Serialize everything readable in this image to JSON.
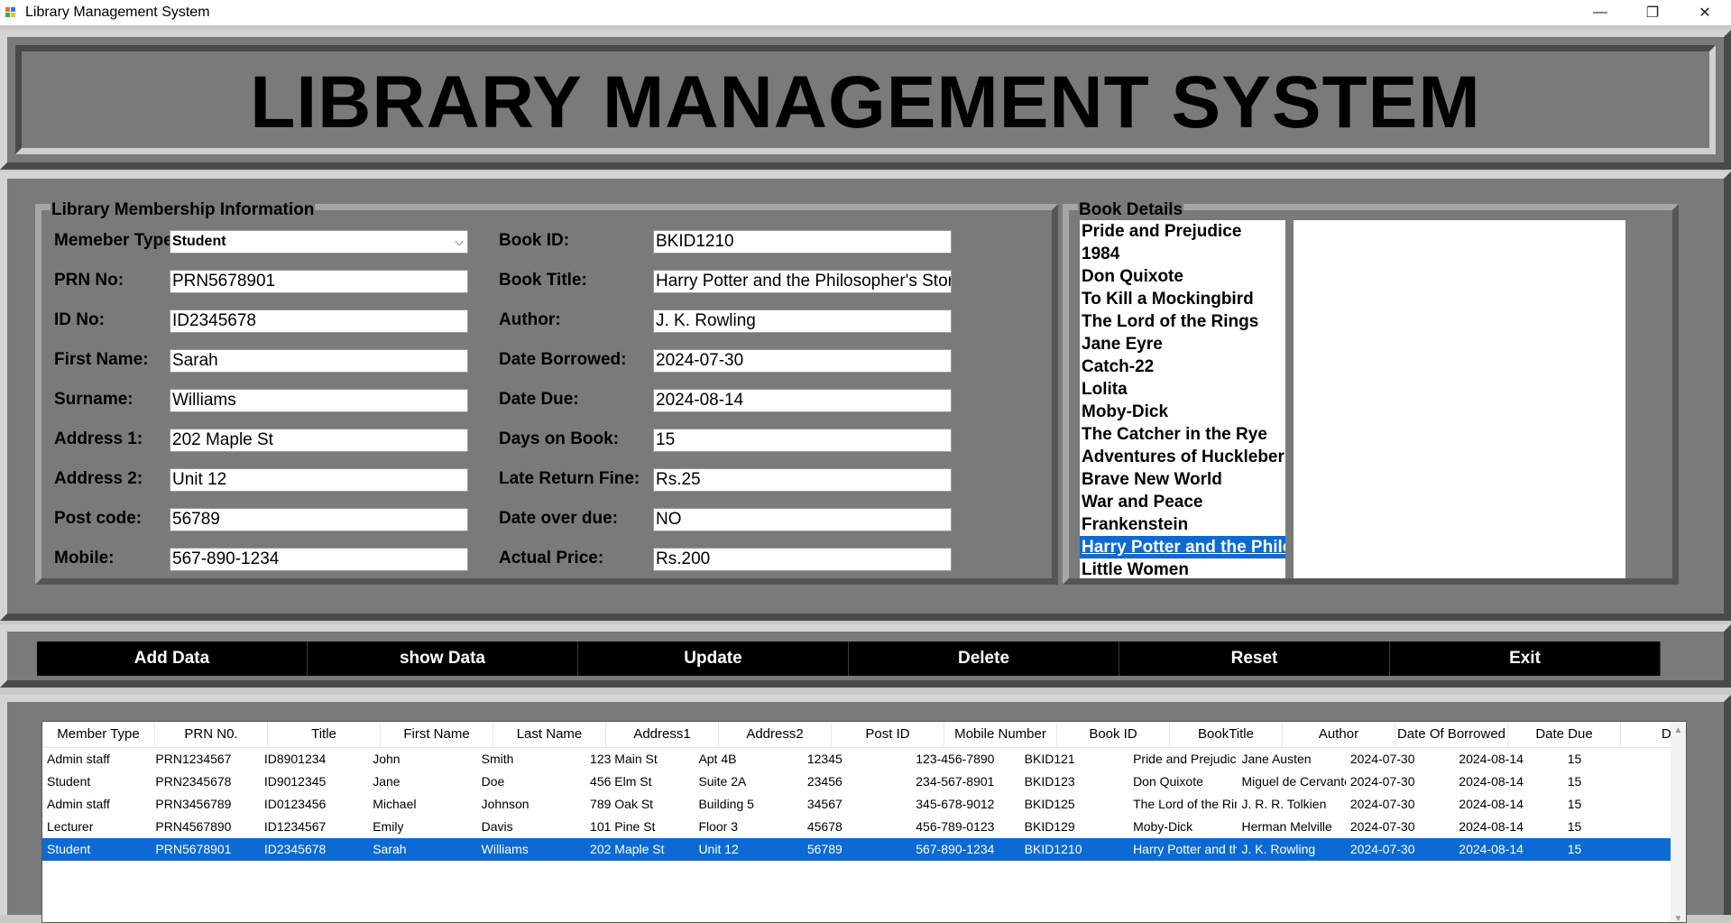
{
  "window": {
    "title": "Library Management System",
    "controls": {
      "minimize": "—",
      "maximize": "❐",
      "close": "✕"
    }
  },
  "header": {
    "title": "LIBRARY MANAGEMENT SYSTEM"
  },
  "membership": {
    "legend": "Library Membership Information",
    "member_type_label": "Memeber Type:",
    "member_type_value": "Student",
    "prn_label": "PRN No:",
    "prn_value": "PRN5678901",
    "id_label": "ID No:",
    "id_value": "ID2345678",
    "first_name_label": "First Name:",
    "first_name_value": "Sarah",
    "surname_label": "Surname:",
    "surname_value": "Williams",
    "address1_label": "Address 1:",
    "address1_value": "202 Maple St",
    "address2_label": "Address 2:",
    "address2_value": "Unit 12",
    "postcode_label": "Post code:",
    "postcode_value": "56789",
    "mobile_label": "Mobile:",
    "mobile_value": "567-890-1234",
    "book_id_label": "Book ID:",
    "book_id_value": "BKID1210",
    "book_title_label": "Book Title:",
    "book_title_value": "Harry Potter and the Philosopher's Stone",
    "author_label": "Author:",
    "author_value": "J. K. Rowling",
    "date_borrowed_label": "Date Borrowed:",
    "date_borrowed_value": "2024-07-30",
    "date_due_label": "Date Due:",
    "date_due_value": "2024-08-14",
    "days_on_book_label": "Days on Book:",
    "days_on_book_value": "15",
    "late_fine_label": "Late Return Fine:",
    "late_fine_value": "Rs.25",
    "date_overdue_label": "Date over due:",
    "date_overdue_value": "NO",
    "actual_price_label": "Actual Price:",
    "actual_price_value": "Rs.200"
  },
  "book_details": {
    "legend": "Book Details",
    "books": [
      "Pride and Prejudice",
      "1984",
      "Don Quixote",
      "To Kill a Mockingbird",
      "The Lord of the Rings",
      "Jane Eyre",
      "Catch-22",
      "Lolita",
      "Moby-Dick",
      "The Catcher in the Rye",
      "Adventures of Huckleberry Finn",
      "Brave New World",
      "War and Peace",
      "Frankenstein",
      "Harry Potter and the Philosopher's Stone",
      "Little Women"
    ],
    "selected_index": 14
  },
  "buttons": [
    "Add Data",
    "show Data",
    "Update",
    "Delete",
    "Reset",
    "Exit"
  ],
  "table": {
    "columns": [
      "Member Type",
      "PRN N0.",
      "Title",
      "First Name",
      "Last Name",
      "Address1",
      "Address2",
      "Post ID",
      "Mobile Number",
      "Book ID",
      "BookTitle",
      "Author",
      "Date Of Borrowed",
      "Date Due",
      "Days"
    ],
    "rows": [
      [
        "Admin staff",
        "PRN1234567",
        "ID8901234",
        "John",
        "Smith",
        "123 Main St",
        "Apt 4B",
        "12345",
        "123-456-7890",
        "BKID121",
        "Pride and Prejudice",
        "Jane Austen",
        "2024-07-30",
        "2024-08-14",
        "15"
      ],
      [
        "Student",
        "PRN2345678",
        "ID9012345",
        "Jane",
        "Doe",
        "456 Elm St",
        "Suite 2A",
        "23456",
        "234-567-8901",
        "BKID123",
        "Don Quixote",
        "Miguel de Cervantes",
        "2024-07-30",
        "2024-08-14",
        "15"
      ],
      [
        "Admin staff",
        "PRN3456789",
        "ID0123456",
        "Michael",
        "Johnson",
        "789 Oak St",
        "Building 5",
        "34567",
        "345-678-9012",
        "BKID125",
        "The Lord of the Rings",
        "J. R. R. Tolkien",
        "2024-07-30",
        "2024-08-14",
        "15"
      ],
      [
        "Lecturer",
        "PRN4567890",
        "ID1234567",
        "Emily",
        "Davis",
        "101 Pine St",
        "Floor 3",
        "45678",
        "456-789-0123",
        "BKID129",
        "Moby-Dick",
        "Herman Melville",
        "2024-07-30",
        "2024-08-14",
        "15"
      ],
      [
        "Student",
        "PRN5678901",
        "ID2345678",
        "Sarah",
        "Williams",
        "202 Maple St",
        "Unit 12",
        "56789",
        "567-890-1234",
        "BKID1210",
        "Harry Potter and the Philosopher's Stone",
        "J. K. Rowling",
        "2024-07-30",
        "2024-08-14",
        "15"
      ]
    ],
    "selected_row": 4
  },
  "colors": {
    "selection": "#0b6ad4",
    "panel": "#7a7a7a",
    "button": "#000000"
  }
}
